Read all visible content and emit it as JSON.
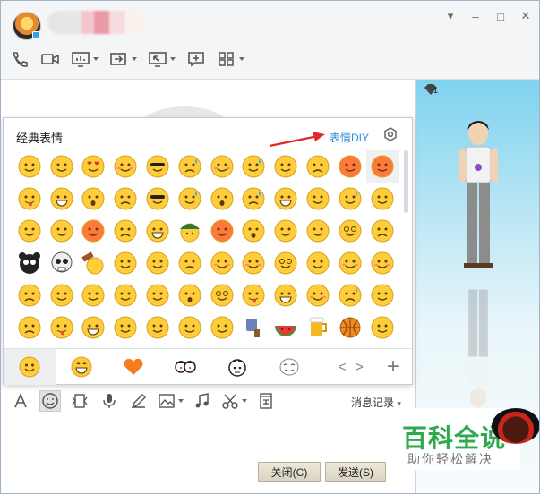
{
  "window": {
    "controls": [
      "dropdown",
      "minimize",
      "maximize",
      "close"
    ]
  },
  "toolbar": {
    "items": [
      "phone-icon",
      "video-icon",
      "screen-share-icon",
      "transfer-file-icon",
      "remote-desktop-icon",
      "message-icon",
      "apps-icon"
    ]
  },
  "emoji_panel": {
    "title": "经典表情",
    "diy_link": "表情DIY",
    "tabs": [
      "classic-face",
      "emoji-face",
      "heart",
      "cartoon-1",
      "cartoon-2",
      "meme"
    ],
    "active_tab": 0,
    "nav_prev": "<",
    "nav_next": ">",
    "add": "+"
  },
  "input_toolbar": {
    "items": [
      "font-icon",
      "emoji-icon",
      "gif-icon",
      "voice-icon",
      "draw-icon",
      "image-icon",
      "music-icon",
      "screenshot-icon",
      "pin-icon"
    ],
    "history_label": "消息记录"
  },
  "buttons": {
    "close_label": "关闭(C)",
    "send_label": "发送(S)"
  },
  "watermark": {
    "title": "百科全说",
    "subtitle": "助你轻松解决"
  },
  "right_panel": {
    "gem_count": "1"
  },
  "colors": {
    "accent": "#2b8fd6",
    "emoji_yellow": "#ffcc3a",
    "watermark_green": "#2fa84f",
    "arrow_red": "#e02a2a"
  }
}
